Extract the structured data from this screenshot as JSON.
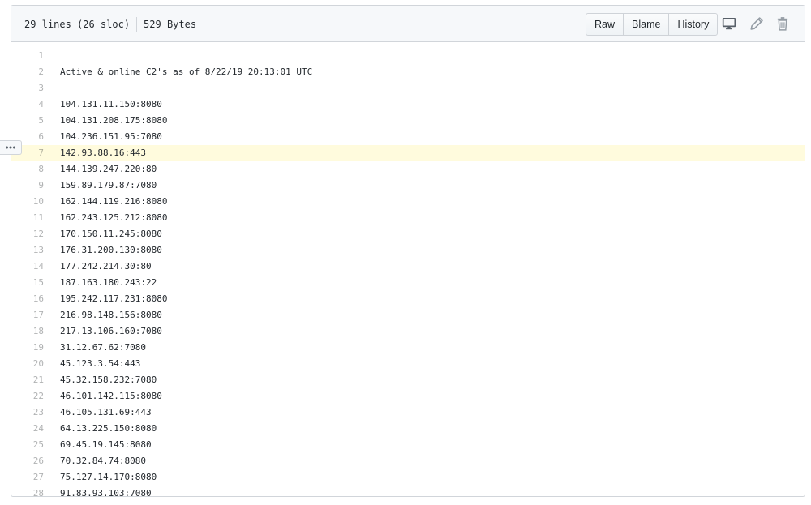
{
  "file_header": {
    "lines_info": "29 lines (26 sloc)",
    "size_info": "529 Bytes",
    "buttons": {
      "raw": "Raw",
      "blame": "Blame",
      "history": "History"
    },
    "icons": {
      "desktop": "desktop-icon",
      "edit": "pencil-icon",
      "delete": "trash-icon"
    }
  },
  "line_actions": {
    "icon": "kebab-horizontal-icon",
    "line": 7
  },
  "highlighted_line": 7,
  "lines": [
    {
      "num": "1",
      "text": ""
    },
    {
      "num": "2",
      "text": "Active & online C2's as of 8/22/19 20:13:01 UTC"
    },
    {
      "num": "3",
      "text": ""
    },
    {
      "num": "4",
      "text": "104.131.11.150:8080"
    },
    {
      "num": "5",
      "text": "104.131.208.175:8080"
    },
    {
      "num": "6",
      "text": "104.236.151.95:7080"
    },
    {
      "num": "7",
      "text": "142.93.88.16:443"
    },
    {
      "num": "8",
      "text": "144.139.247.220:80"
    },
    {
      "num": "9",
      "text": "159.89.179.87:7080"
    },
    {
      "num": "10",
      "text": "162.144.119.216:8080"
    },
    {
      "num": "11",
      "text": "162.243.125.212:8080"
    },
    {
      "num": "12",
      "text": "170.150.11.245:8080"
    },
    {
      "num": "13",
      "text": "176.31.200.130:8080"
    },
    {
      "num": "14",
      "text": "177.242.214.30:80"
    },
    {
      "num": "15",
      "text": "187.163.180.243:22"
    },
    {
      "num": "16",
      "text": "195.242.117.231:8080"
    },
    {
      "num": "17",
      "text": "216.98.148.156:8080"
    },
    {
      "num": "18",
      "text": "217.13.106.160:7080"
    },
    {
      "num": "19",
      "text": "31.12.67.62:7080"
    },
    {
      "num": "20",
      "text": "45.123.3.54:443"
    },
    {
      "num": "21",
      "text": "45.32.158.232:7080"
    },
    {
      "num": "22",
      "text": "46.101.142.115:8080"
    },
    {
      "num": "23",
      "text": "46.105.131.69:443"
    },
    {
      "num": "24",
      "text": "64.13.225.150:8080"
    },
    {
      "num": "25",
      "text": "69.45.19.145:8080"
    },
    {
      "num": "26",
      "text": "70.32.84.74:8080"
    },
    {
      "num": "27",
      "text": "75.127.14.170:8080"
    },
    {
      "num": "28",
      "text": "91.83.93.103:7080"
    }
  ]
}
